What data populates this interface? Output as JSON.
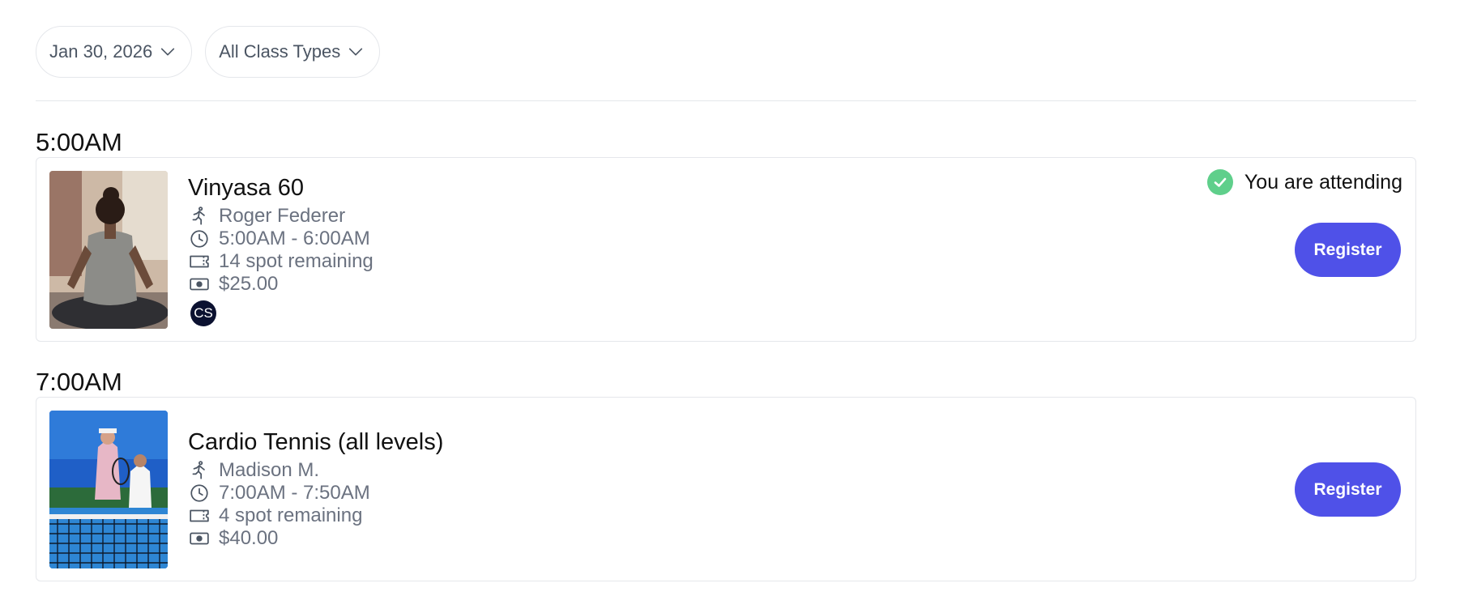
{
  "filters": {
    "date": {
      "label": "Jan 30, 2026",
      "icon": "chevron-down-icon"
    },
    "class_type": {
      "label": "All Class Types",
      "icon": "chevron-down-icon"
    }
  },
  "schedule": [
    {
      "time": "5:00AM",
      "class": {
        "title": "Vinyasa 60",
        "instructor": "Roger Federer",
        "time_range": "5:00AM - 6:00AM",
        "spots": "14 spot remaining",
        "price": "$25.00",
        "attendee_initials": "CS",
        "status": "You are attending",
        "register_label": "Register"
      }
    },
    {
      "time": "7:00AM",
      "class": {
        "title": "Cardio Tennis (all levels)",
        "instructor": "Madison M.",
        "time_range": "7:00AM - 7:50AM",
        "spots": "4 spot remaining",
        "price": "$40.00",
        "register_label": "Register"
      }
    }
  ],
  "colors": {
    "accent": "#4f51e8",
    "success": "#5fcf8b",
    "muted_text": "#6b7280",
    "border": "#e5e7eb"
  }
}
